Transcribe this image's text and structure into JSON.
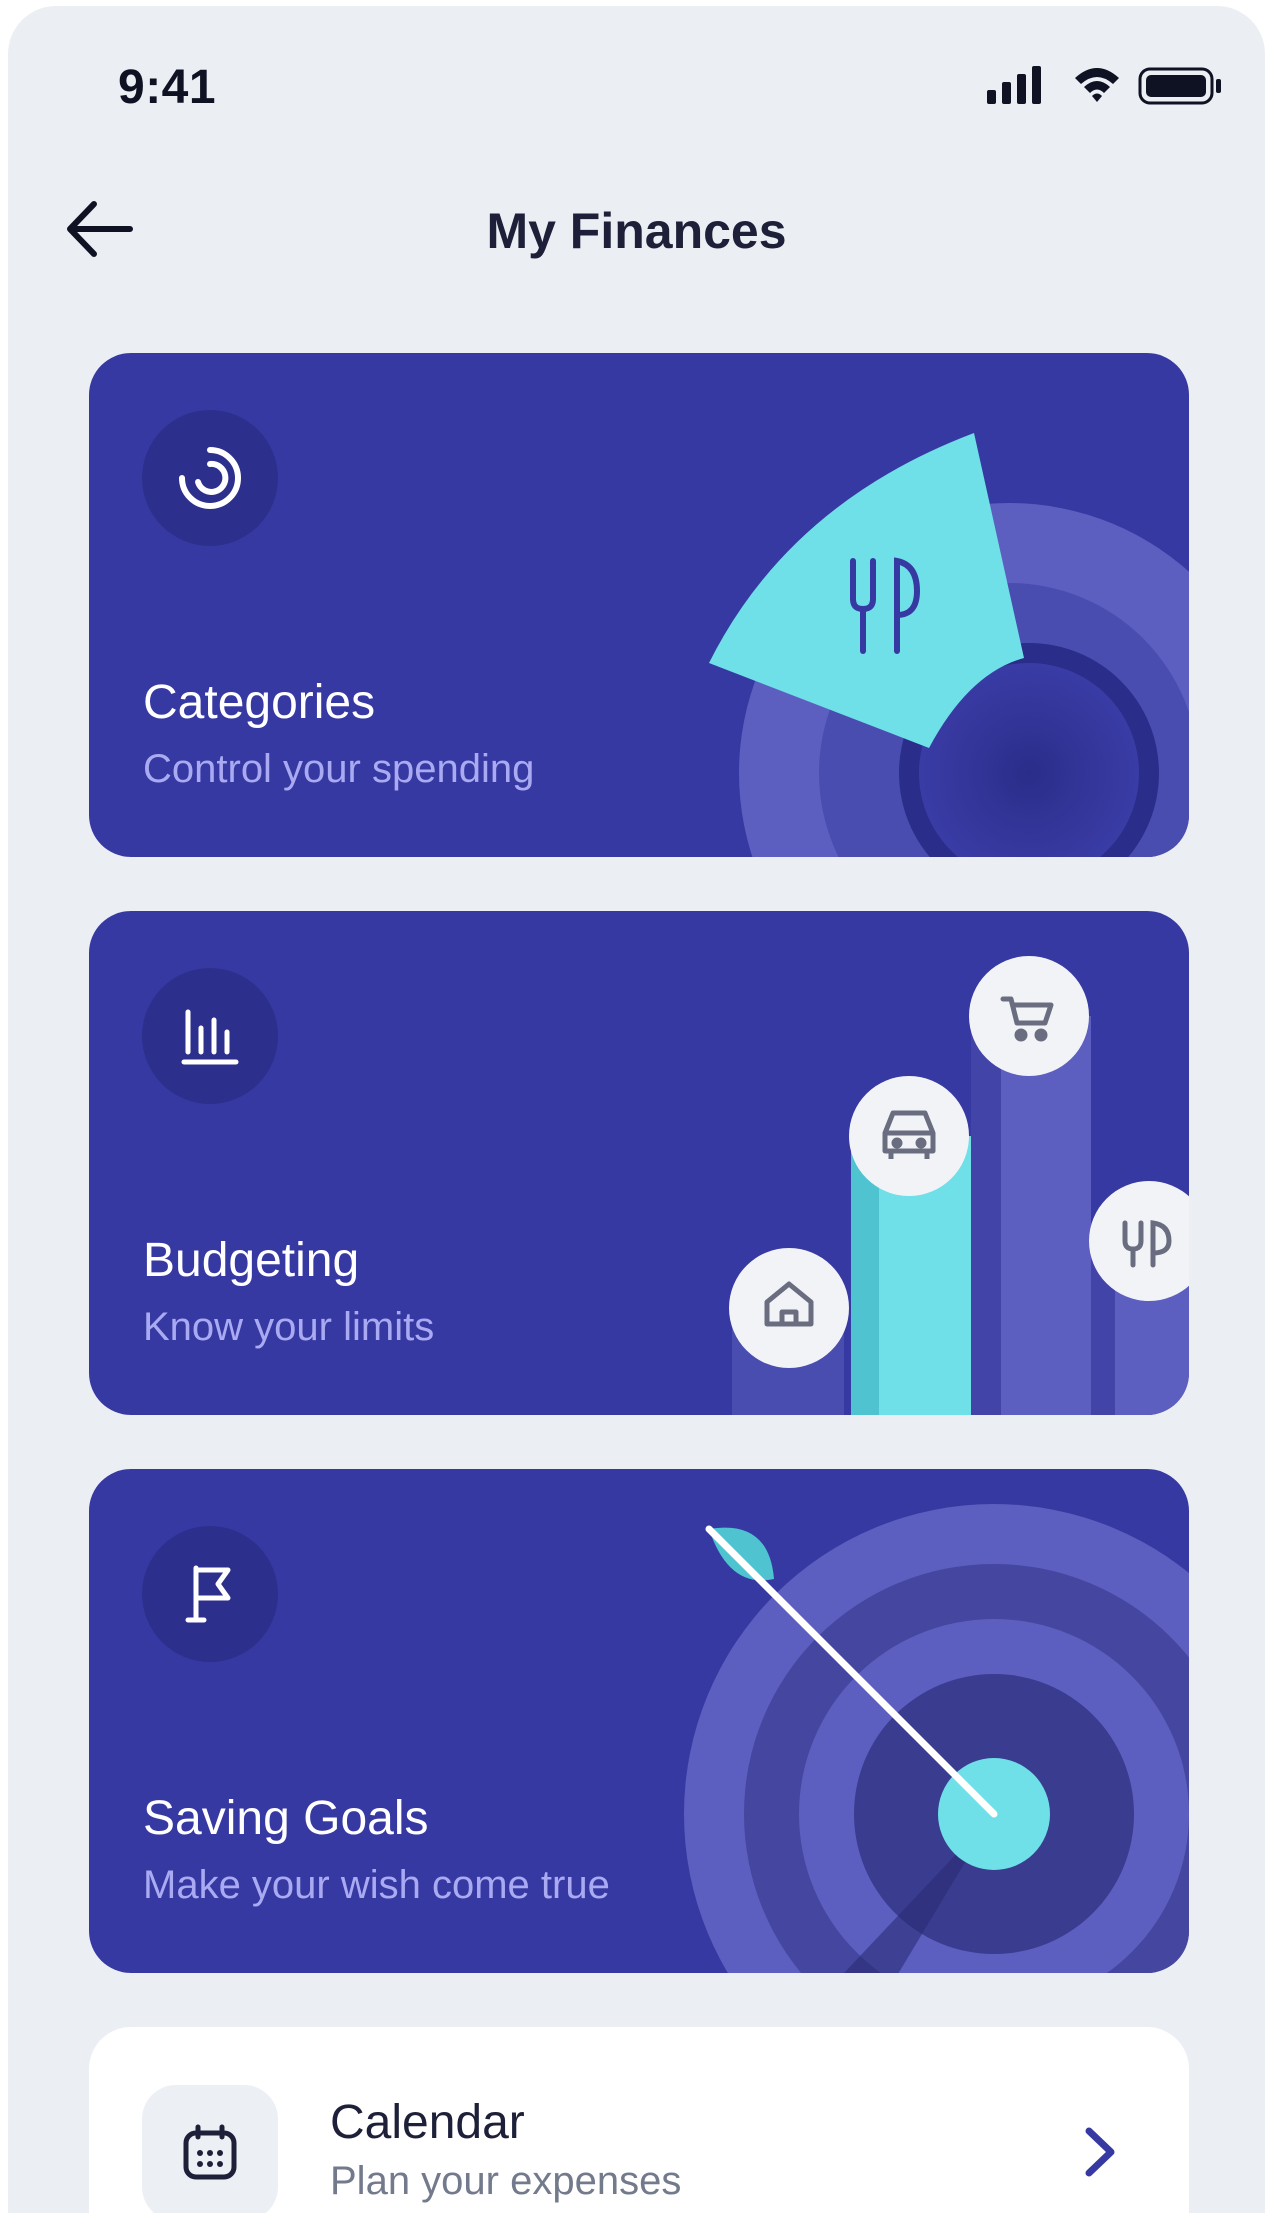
{
  "status_bar": {
    "time": "9:41",
    "icons": [
      "signal-icon",
      "wifi-icon",
      "battery-icon"
    ]
  },
  "header": {
    "back_icon": "arrow-left-icon",
    "title": "My Finances"
  },
  "cards": [
    {
      "icon": "pie-spinner-icon",
      "title": "Categories",
      "subtitle": "Control your spending",
      "art_icon": "fork-knife-icon"
    },
    {
      "icon": "bar-chart-icon",
      "title": "Budgeting",
      "subtitle": "Know your limits",
      "art_icons": [
        "home-icon",
        "car-icon",
        "cart-icon",
        "fork-knife-icon"
      ]
    },
    {
      "icon": "flag-icon",
      "title": "Saving Goals",
      "subtitle": "Make your wish come true",
      "art_icon": "target-arrow-icon"
    }
  ],
  "calendar": {
    "icon": "calendar-icon",
    "title": "Calendar",
    "subtitle": "Plan your expenses",
    "action_icon": "chevron-right-icon"
  },
  "colors": {
    "background": "#ebeef3",
    "card": "#3739a3",
    "icon_circle": "#2d2f8c",
    "accent_cyan": "#6fdfe8",
    "accent_lavender": "#5c5fc0",
    "subtitle": "#a9aaf2"
  }
}
